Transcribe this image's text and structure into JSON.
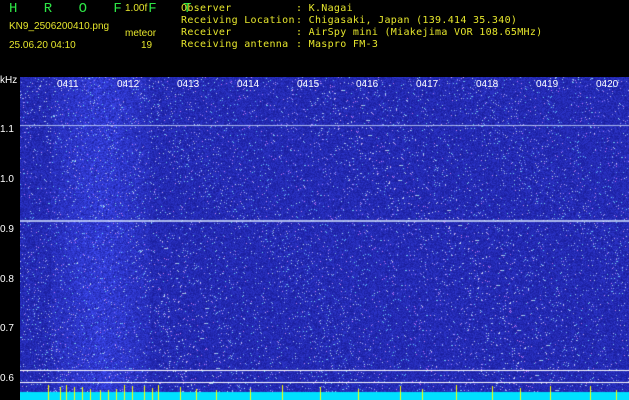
{
  "header": {
    "brand": "H R O F F T",
    "version": "1.00f",
    "filename": "KN9_2506200410.png",
    "meteor_label": "meteor",
    "datetime": "25.06.20 04:10",
    "meteor_count": "19",
    "info": [
      {
        "key": "Observer",
        "value": ": K.Nagai"
      },
      {
        "key": "Receiving Location",
        "value": ": Chigasaki, Japan (139.414 35.340)"
      },
      {
        "key": "Receiver",
        "value": ": AirSpy mini (Miakejima VOR 108.65MHz)"
      },
      {
        "key": "Receiving antenna",
        "value": ": Maspro FM-3"
      }
    ]
  },
  "spectrogram": {
    "y_unit": "kHz",
    "y_ticks": [
      "1.1",
      "1.0",
      "0.9",
      "0.8",
      "0.7",
      "0.6"
    ],
    "x_ticks": [
      "0411",
      "0412",
      "0413",
      "0414",
      "0415",
      "0416",
      "0417",
      "0418",
      "0419",
      "0420"
    ],
    "colors": {
      "background": "#0a0a8c",
      "noise": "#3a4cff",
      "signal": "#d8e8ff",
      "baseline": "#00e0ff",
      "marks": "#ffff00",
      "frame": "#ffffff"
    }
  }
}
